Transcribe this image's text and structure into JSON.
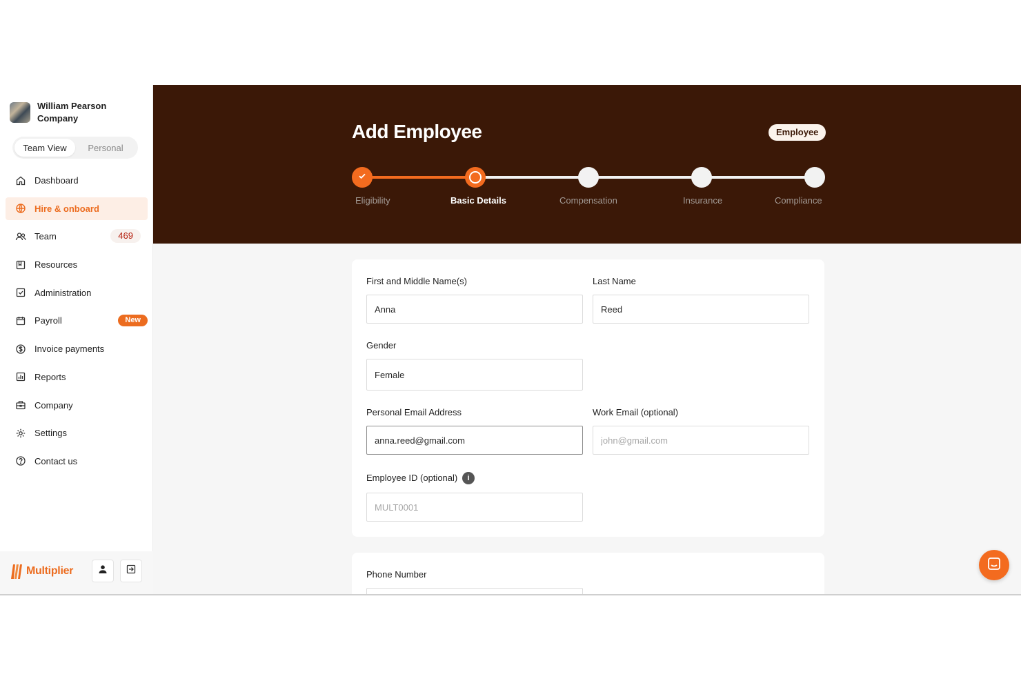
{
  "user": {
    "name": "William Pearson Company"
  },
  "view_toggle": {
    "team": "Team View",
    "personal": "Personal"
  },
  "nav": {
    "items": [
      {
        "label": "Dashboard",
        "icon": "home-icon"
      },
      {
        "label": "Hire & onboard",
        "icon": "globe-icon"
      },
      {
        "label": "Team",
        "icon": "users-icon",
        "count": "469"
      },
      {
        "label": "Resources",
        "icon": "book-icon"
      },
      {
        "label": "Administration",
        "icon": "clipboard-check-icon"
      },
      {
        "label": "Payroll",
        "icon": "calendar-icon",
        "badge": "New"
      },
      {
        "label": "Invoice payments",
        "icon": "dollar-circle-icon"
      },
      {
        "label": "Reports",
        "icon": "bar-chart-icon"
      },
      {
        "label": "Company",
        "icon": "briefcase-icon"
      },
      {
        "label": "Settings",
        "icon": "gear-icon"
      },
      {
        "label": "Contact us",
        "icon": "help-circle-icon"
      }
    ]
  },
  "footer": {
    "logo_text": "Multiplier"
  },
  "header": {
    "title": "Add Employee",
    "type_badge": "Employee"
  },
  "steps": [
    {
      "label": "Eligibility",
      "state": "done"
    },
    {
      "label": "Basic Details",
      "state": "current"
    },
    {
      "label": "Compensation",
      "state": "upcoming"
    },
    {
      "label": "Insurance",
      "state": "upcoming"
    },
    {
      "label": "Compliance",
      "state": "upcoming"
    }
  ],
  "form": {
    "first_name": {
      "label": "First and Middle Name(s)",
      "value": "Anna"
    },
    "last_name": {
      "label": "Last Name",
      "value": "Reed"
    },
    "gender": {
      "label": "Gender",
      "value": "Female"
    },
    "personal_email": {
      "label": "Personal Email Address",
      "value": "anna.reed@gmail.com"
    },
    "work_email": {
      "label": "Work Email (optional)",
      "placeholder": "john@gmail.com"
    },
    "employee_id": {
      "label": "Employee ID (optional)",
      "placeholder": "MULT0001"
    },
    "phone": {
      "label": "Phone Number"
    }
  },
  "colors": {
    "accent": "#f36b1f",
    "header_bg": "#3b1807",
    "count_text": "#b4200f"
  }
}
